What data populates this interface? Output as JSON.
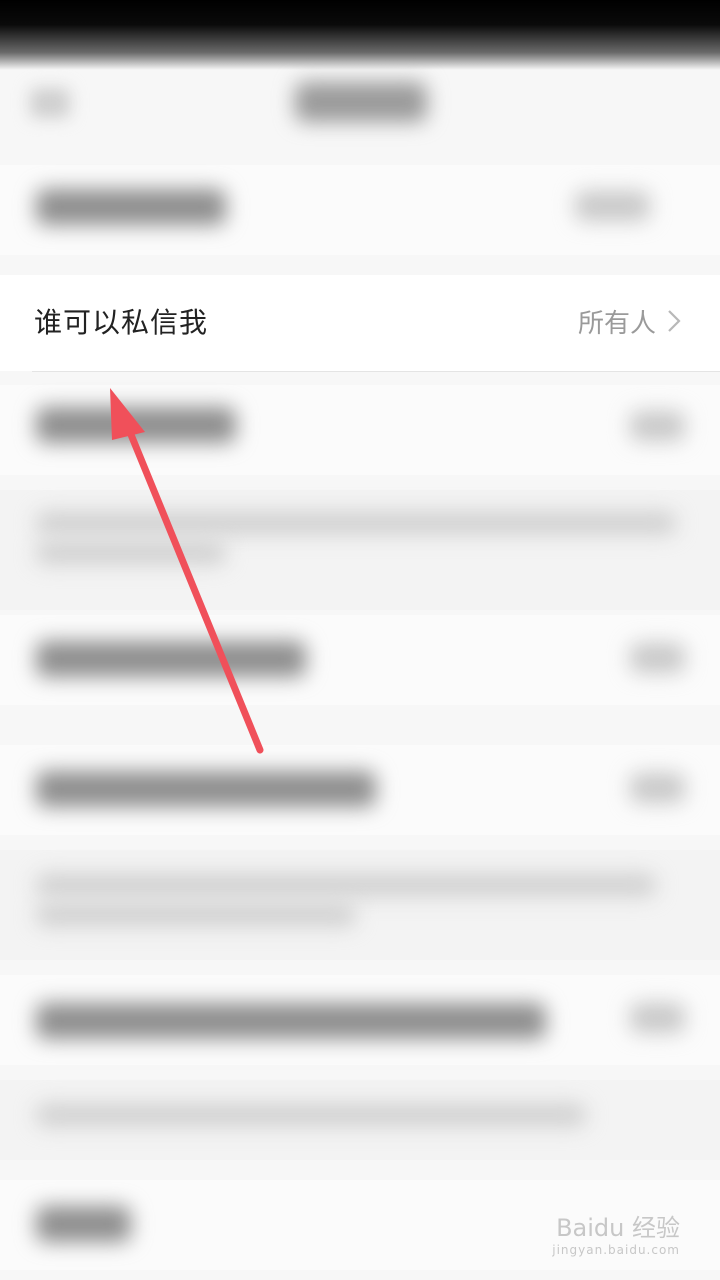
{
  "setting_row": {
    "label": "谁可以私信我",
    "value": "所有人"
  },
  "watermark": {
    "brand": "Baidu 经验",
    "url": "jingyan.baidu.com"
  },
  "annotation": {
    "arrow_color": "#f0505a"
  }
}
